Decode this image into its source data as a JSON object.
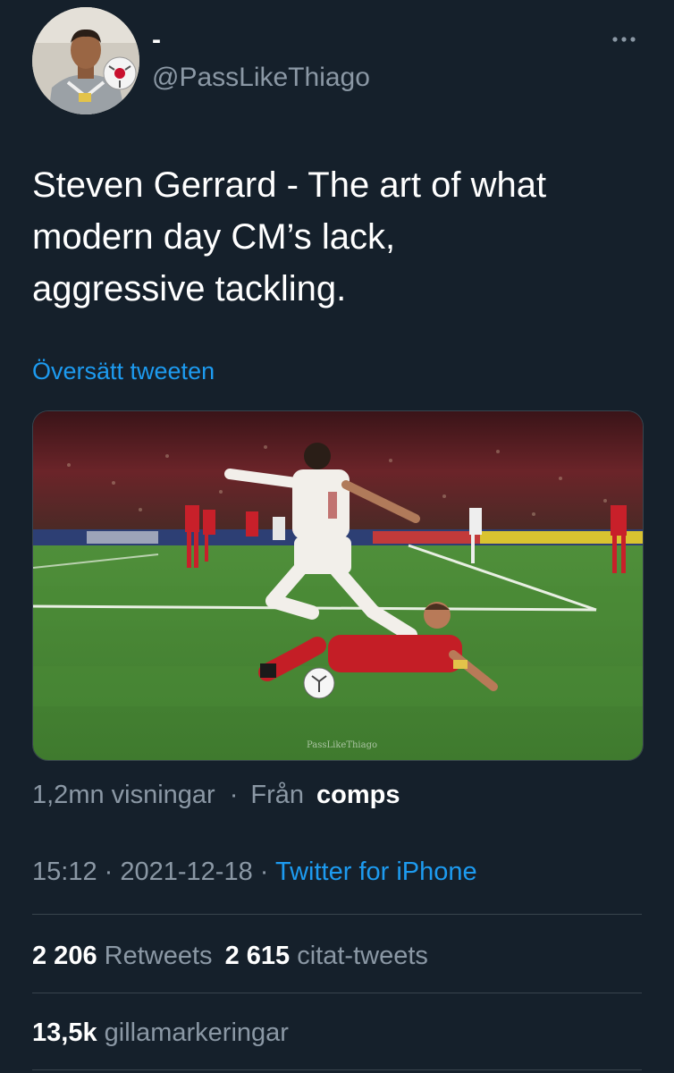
{
  "author": {
    "display_name": "-",
    "handle": "@PassLikeThiago"
  },
  "tweet": {
    "text": "Steven Gerrard - The art of what\nmodern day CM’s lack,\naggressive tackling.",
    "translate_label": "Översätt tweeten",
    "media_watermark": "PassLikeThiago"
  },
  "views": {
    "count_text": "1,2mn visningar",
    "separator": "·",
    "source_prefix": "Från",
    "source_name": "comps"
  },
  "meta": {
    "time": "15:12",
    "separator": "·",
    "date": "2021-12-18",
    "client": "Twitter for iPhone"
  },
  "stats": {
    "retweets_count": "2 206",
    "retweets_label": "Retweets",
    "quotes_count": "2 615",
    "quotes_label": "citat-tweets",
    "likes_count": "13,5k",
    "likes_label": "gillamarkeringar"
  },
  "colors": {
    "background": "#15202b",
    "link": "#1d9bf0",
    "secondary_text": "#8b98a5",
    "divider": "#38444d"
  },
  "icons": {
    "more": "more-dots-icon"
  }
}
